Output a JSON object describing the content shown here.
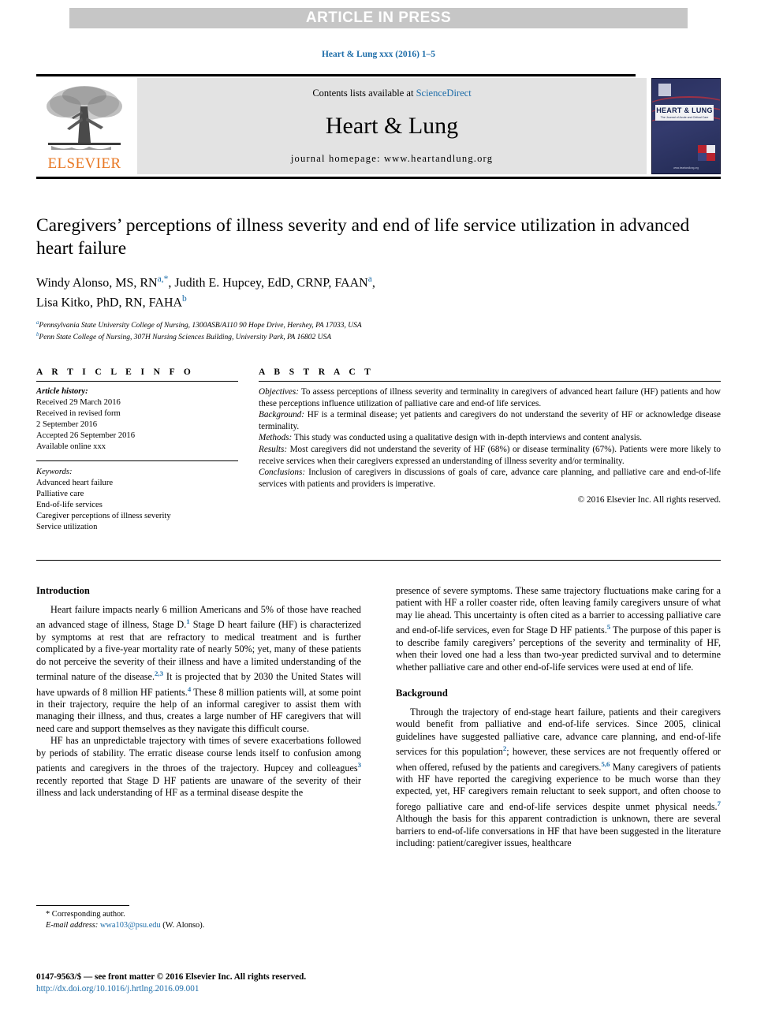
{
  "banner": {
    "text": "ARTICLE IN PRESS"
  },
  "running_head": {
    "text": "Heart & Lung xxx (2016) 1–5"
  },
  "masthead": {
    "contents_prefix": "Contents lists available at ",
    "contents_link": "ScienceDirect",
    "journal_title": "Heart & Lung",
    "homepage": "journal homepage: www.heartandlung.org",
    "publisher_wordmark": "ELSEVIER",
    "cover_banner_title": "HEART & LUNG",
    "cover_banner_sub": "The Journal of Acute and Critical Care",
    "cover_url": "www.heartandlung.org"
  },
  "article": {
    "title": "Caregivers’ perceptions of illness severity and end of life service utilization in advanced heart failure",
    "authors_line1_a": "Windy Alonso, MS, RN",
    "authors_sup1": "a,*",
    "authors_line1_b": ", Judith E. Hupcey, EdD, CRNP, FAAN",
    "authors_sup2": "a",
    "authors_line1_c": ",",
    "authors_line2_a": "Lisa Kitko, PhD, RN, FAHA",
    "authors_sup3": "b",
    "affiliation_a_sup": "a",
    "affiliation_a": "Pennsylvania State University College of Nursing, 1300ASB/A110 90 Hope Drive, Hershey, PA 17033, USA",
    "affiliation_b_sup": "b",
    "affiliation_b": "Penn State College of Nursing, 307H Nursing Sciences Building, University Park, PA 16802 USA"
  },
  "article_info": {
    "heading": "A R T I C L E   I N F O",
    "history_label": "Article history:",
    "history": [
      "Received 29 March 2016",
      "Received in revised form",
      "2 September 2016",
      "Accepted 26 September 2016",
      "Available online xxx"
    ],
    "keywords_label": "Keywords:",
    "keywords": [
      "Advanced heart failure",
      "Palliative care",
      "End-of-life services",
      "Caregiver perceptions of illness severity",
      "Service utilization"
    ]
  },
  "abstract": {
    "heading": "A B S T R A C T",
    "sections": [
      {
        "label": "Objectives:",
        "text": " To assess perceptions of illness severity and terminality in caregivers of advanced heart failure (HF) patients and how these perceptions influence utilization of palliative care and end-of life services."
      },
      {
        "label": "Background:",
        "text": " HF is a terminal disease; yet patients and caregivers do not understand the severity of HF or acknowledge disease terminality."
      },
      {
        "label": "Methods:",
        "text": " This study was conducted using a qualitative design with in-depth interviews and content analysis."
      },
      {
        "label": "Results:",
        "text": " Most caregivers did not understand the severity of HF (68%) or disease terminality (67%). Patients were more likely to receive services when their caregivers expressed an understanding of illness severity and/or terminality."
      },
      {
        "label": "Conclusions:",
        "text": " Inclusion of caregivers in discussions of goals of care, advance care planning, and palliative care and end-of-life services with patients and providers is imperative."
      }
    ],
    "copyright": "© 2016 Elsevier Inc. All rights reserved."
  },
  "body": {
    "left": {
      "introduction_heading": "Introduction",
      "p1_part1": "Heart failure impacts nearly 6 million Americans and 5% of those have reached an advanced stage of illness, Stage D.",
      "p1_ref1": "1",
      "p1_part2": " Stage D heart failure (HF) is characterized by symptoms at rest that are refractory to medical treatment and is further complicated by a five-year mortality rate of nearly 50%; yet, many of these patients do not perceive the severity of their illness and have a limited understanding of the terminal nature of the disease.",
      "p1_ref2": "2,3",
      "p1_part3": " It is projected that by 2030 the United States will have upwards of 8 million HF patients.",
      "p1_ref3": "4",
      "p1_part4": " These 8 million patients will, at some point in their trajectory, require the help of an informal caregiver to assist them with managing their illness, and thus, creates a large number of HF caregivers that will need care and support themselves as they navigate this difficult course.",
      "p2_part1": "HF has an unpredictable trajectory with times of severe exacerbations followed by periods of stability. The erratic disease course lends itself to confusion among patients and caregivers in the throes of the trajectory. Hupcey and colleagues",
      "p2_ref1": "3",
      "p2_part2": " recently reported that Stage D HF patients are unaware of the severity of their illness and lack understanding of HF as a terminal disease despite the"
    },
    "right": {
      "p1_part1": "presence of severe symptoms. These same trajectory fluctuations make caring for a patient with HF a roller coaster ride, often leaving family caregivers unsure of what may lie ahead. This uncertainty is often cited as a barrier to accessing palliative care and end-of-life services, even for Stage D HF patients.",
      "p1_ref1": "5",
      "p1_part2": " The purpose of this paper is to describe family caregivers’ perceptions of the severity and terminality of HF, when their loved one had a less than two-year predicted survival and to determine whether palliative care and other end-of-life services were used at end of life.",
      "background_heading": "Background",
      "p2_part1": "Through the trajectory of end-stage heart failure, patients and their caregivers would benefit from palliative and end-of-life services. Since 2005, clinical guidelines have suggested palliative care, advance care planning, and end-of-life services for this population",
      "p2_ref1": "2",
      "p2_part2": "; however, these services are not frequently offered or when offered, refused by the patients and caregivers.",
      "p2_ref2": "5,6",
      "p2_part3": " Many caregivers of patients with HF have reported the caregiving experience to be much worse than they expected, yet, HF caregivers remain reluctant to seek support, and often choose to forego palliative care and end-of-life services despite unmet physical needs.",
      "p2_ref3": "7",
      "p2_part4": " Although the basis for this apparent contradiction is unknown, there are several barriers to end-of-life conversations in HF that have been suggested in the literature including: patient/caregiver issues, healthcare"
    }
  },
  "footnote": {
    "corresponding": "* Corresponding author.",
    "email_label": "E-mail address:",
    "email": "wwa103@psu.edu",
    "email_owner": " (W. Alonso)."
  },
  "footer": {
    "issn_line": "0147-9563/$ — see front matter © 2016 Elsevier Inc. All rights reserved.",
    "doi": "http://dx.doi.org/10.1016/j.hrtlng.2016.09.001"
  },
  "colors": {
    "link_blue": "#1c6ca8",
    "elsevier_orange": "#E87722",
    "banner_gray": "#c6c6c6",
    "band_gray": "#e3e3e3",
    "cover_navy": "#2b3160"
  }
}
